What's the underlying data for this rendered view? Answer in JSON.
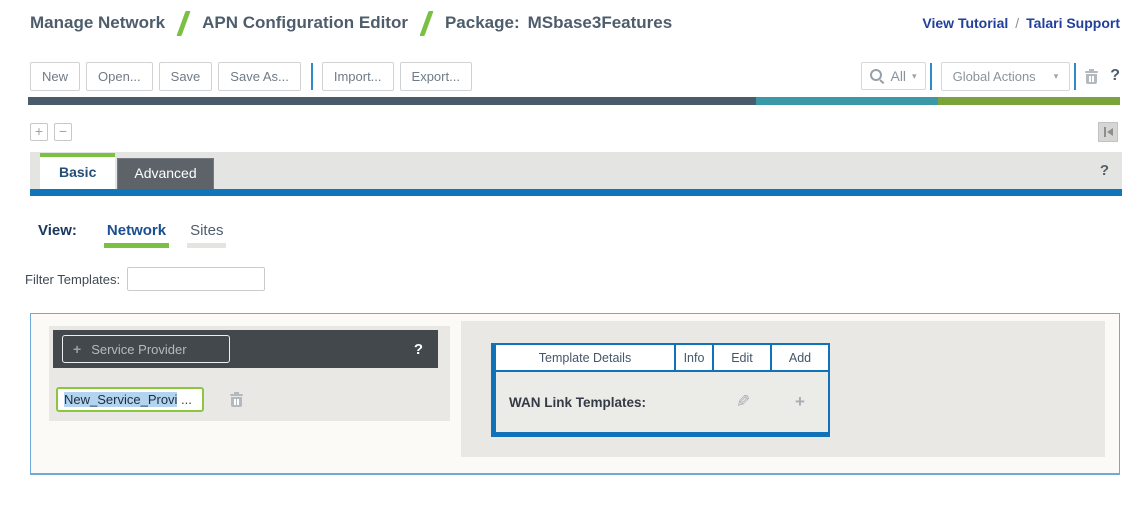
{
  "header": {
    "breadcrumb": [
      "Manage Network",
      "APN Configuration Editor"
    ],
    "package_label": "Package:",
    "package_name": "MSbase3Features",
    "tutorial_link": "View Tutorial",
    "support_link": "Talari Support",
    "link_separator": "/"
  },
  "toolbar": {
    "new": "New",
    "open": "Open...",
    "save": "Save",
    "save_as": "Save As...",
    "import": "Import...",
    "export": "Export...",
    "search_scope": "All",
    "global_actions": "Global Actions",
    "help": "?"
  },
  "tree_controls": {
    "expand": "+",
    "collapse": "−"
  },
  "tabs": {
    "basic": "Basic",
    "advanced": "Advanced",
    "help": "?"
  },
  "view_bar": {
    "label": "View:",
    "network": "Network",
    "sites": "Sites"
  },
  "filter": {
    "label": "Filter Templates:",
    "value": ""
  },
  "service_provider_panel": {
    "add_icon": "+",
    "add_label": "Service Provider",
    "help": "?",
    "name_selected": "New_Service_Provi",
    "name_suffix": " ..."
  },
  "templates_table": {
    "columns": [
      "Template Details",
      "Info",
      "Edit",
      "Add"
    ],
    "row_label": "WAN Link Templates:",
    "edit_icon": "✎",
    "add_icon": "+"
  },
  "icons": {
    "caret": "▾"
  },
  "colors": {
    "accent_green": "#7ac143",
    "link_navy": "#21409a",
    "bar_slate": "#4a5b6c",
    "bar_teal": "#3a98a7",
    "bar_olive": "#7aa33c",
    "table_blue": "#1172ba",
    "panel_header_dark": "#43484d",
    "tab_blue_bar": "#0f76bc"
  }
}
